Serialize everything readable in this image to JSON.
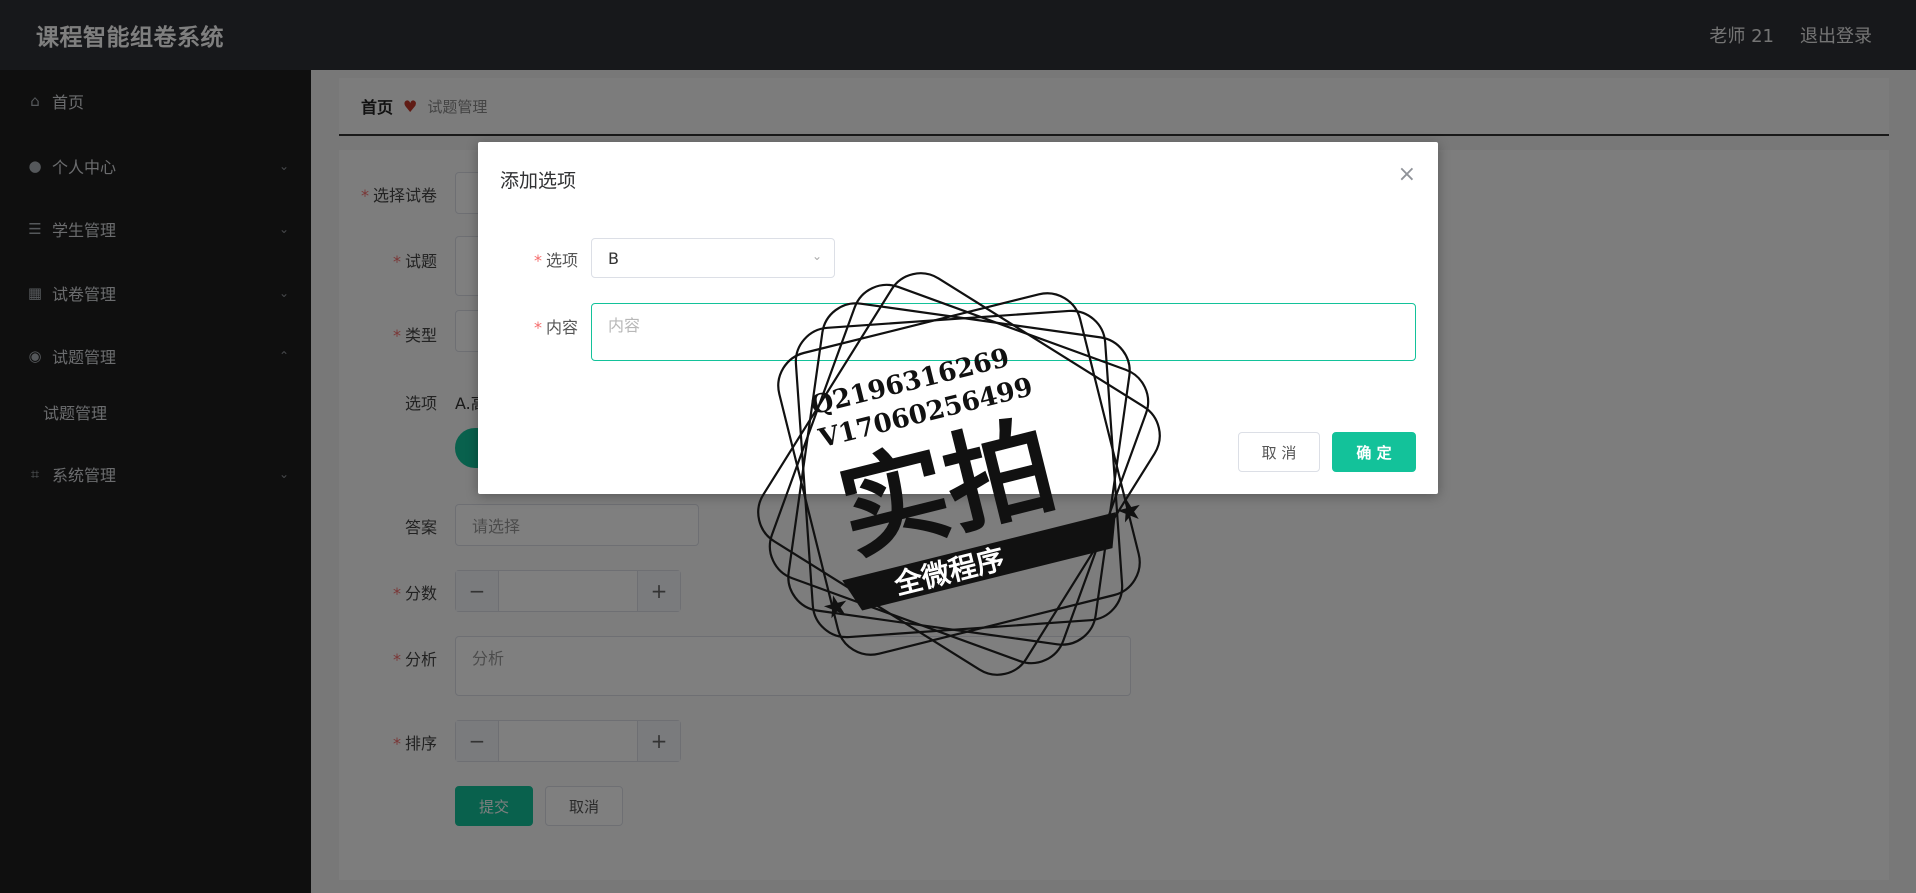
{
  "app": {
    "title": "课程智能组卷系统"
  },
  "header": {
    "user": "老师 21",
    "logout": "退出登录"
  },
  "sidebar": {
    "items": [
      {
        "label": "首页"
      },
      {
        "label": "个人中心"
      },
      {
        "label": "学生管理"
      },
      {
        "label": "试卷管理"
      },
      {
        "label": "试题管理"
      },
      {
        "label": "系统管理"
      }
    ],
    "sub_items": [
      {
        "label": "试题管理"
      }
    ]
  },
  "breadcrumb": {
    "home": "首页",
    "current": "试题管理"
  },
  "form": {
    "paper_label": "选择试卷",
    "question_label": "试题",
    "type_label": "类型",
    "options_label": "选项",
    "options_text": "A.高",
    "answer_label": "答案",
    "answer_placeholder": "请选择",
    "score_label": "分数",
    "analysis_label": "分析",
    "analysis_placeholder": "分析",
    "order_label": "排序",
    "submit": "提交",
    "cancel": "取消"
  },
  "dialog": {
    "title": "添加选项",
    "option_label": "选项",
    "option_value": "B",
    "content_label": "内容",
    "content_placeholder": "内容",
    "cancel": "取 消",
    "confirm": "确 定"
  },
  "watermark": {
    "line1": "Q2196316269",
    "line2": "V17060256499",
    "big": "实拍",
    "ribbon": "全微程序"
  },
  "colors": {
    "accent": "#13c29a",
    "sidebar": "#1f1f1f",
    "topbar": "#2f3136",
    "required": "#f56c6c"
  }
}
